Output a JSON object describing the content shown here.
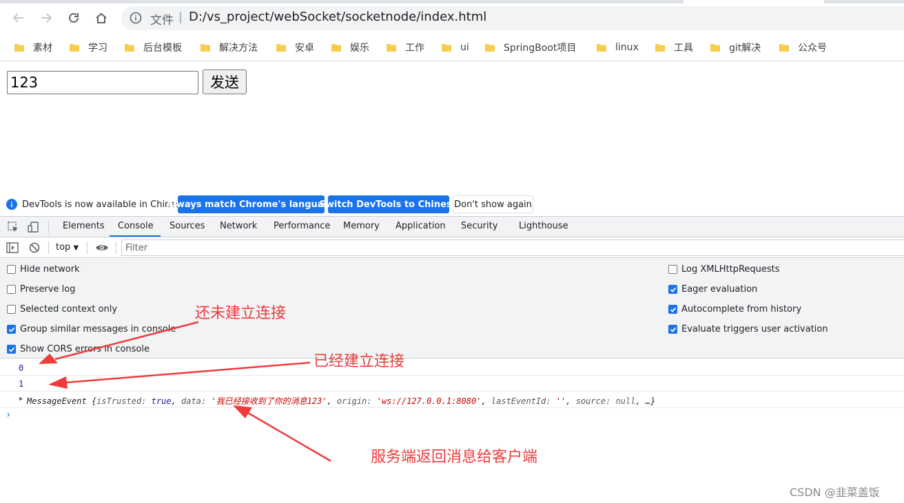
{
  "browser": {
    "url_label": "文件",
    "url_separator": "|",
    "url": "D:/vs_project/webSocket/socketnode/index.html"
  },
  "bookmarks": [
    "素材",
    "学习",
    "后台模板",
    "解决方法",
    "安卓",
    "娱乐",
    "工作",
    "ui",
    "SpringBoot项目",
    "linux",
    "工具",
    "git解决",
    "公众号"
  ],
  "page": {
    "input_value": "123",
    "send_label": "发送"
  },
  "devtools": {
    "infobar": {
      "message": "DevTools is now available in Chinese!",
      "btn_match": "Always match Chrome's language",
      "btn_switch": "Switch DevTools to Chinese",
      "btn_dismiss": "Don't show again"
    },
    "tabs": [
      "Elements",
      "Console",
      "Sources",
      "Network",
      "Performance",
      "Memory",
      "Application",
      "Security",
      "Lighthouse"
    ],
    "active_tab": "Console",
    "context": "top",
    "filter_placeholder": "Filter",
    "settings_left": [
      {
        "label": "Hide network",
        "checked": false
      },
      {
        "label": "Preserve log",
        "checked": false
      },
      {
        "label": "Selected context only",
        "checked": false
      },
      {
        "label": "Group similar messages in console",
        "checked": true
      },
      {
        "label": "Show CORS errors in console",
        "checked": true
      }
    ],
    "settings_right": [
      {
        "label": "Log XMLHttpRequests",
        "checked": false
      },
      {
        "label": "Eager evaluation",
        "checked": true
      },
      {
        "label": "Autocomplete from history",
        "checked": true
      },
      {
        "label": "Evaluate triggers user activation",
        "checked": true
      }
    ],
    "console_lines": {
      "line1": "0",
      "line2": "1",
      "event_name": "MessageEvent",
      "event_body": {
        "open": " {",
        "k1": "isTrusted: ",
        "v1": "true",
        "c1": ", ",
        "k2": "data: ",
        "v2": "'我已经接收到了你的消息123'",
        "c2": ", ",
        "k3": "origin: ",
        "v3": "'ws://127.0.0.1:8080'",
        "c3": ", ",
        "k4": "lastEventId: ",
        "v4": "''",
        "c4": ", ",
        "k5": "source: ",
        "v5": "null",
        "c5": ", …}"
      },
      "prompt": "›"
    }
  },
  "annotations": {
    "not_connected": "还未建立连接",
    "connected": "已经建立连接",
    "server_reply": "服务端返回消息给客户端"
  },
  "watermark": "CSDN @韭菜盖饭",
  "colors": {
    "accent": "#1a73e8",
    "annotation": "#ee3b3b"
  }
}
